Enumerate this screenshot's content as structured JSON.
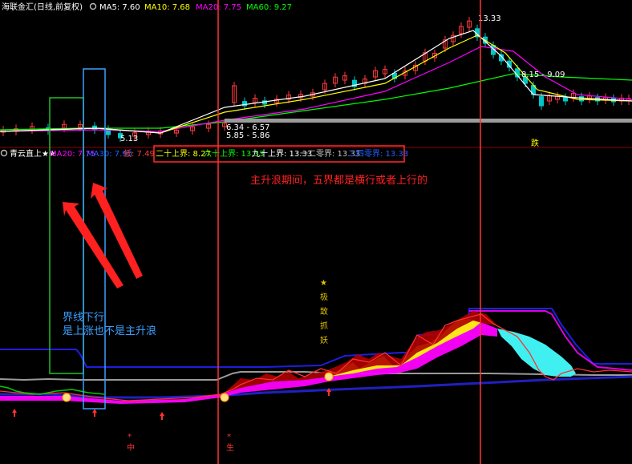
{
  "colors": {
    "bg": "#000000",
    "up": "#ff3b3b",
    "down": "#00c8c8",
    "ma5": "#ffffff",
    "ma10": "#ffff00",
    "ma20": "#ff00ff",
    "ma60": "#00ff00",
    "vline": "#ff3333",
    "blue_line": "#1e1ee0",
    "magenta_fill": "#ff00ff",
    "cyan_fill": "#40f0f0",
    "annotation_red": "#ff2020",
    "annotation_blue": "#3ca0ff"
  },
  "upper": {
    "title": "海联金汇(日线,前复权)",
    "ma5_label": "MA5: 7.60",
    "ma10_label": "MA10: 7.68",
    "ma20_label": "MA20: 7.75",
    "ma60_label": "MA60: 9.27",
    "high_label": "13.33",
    "mid_label": "8.15 - 9.09",
    "price_label_a": "6.34 - 6.57",
    "price_label_b": "5.85 - 5.86",
    "low_label": "5.13",
    "bottom_tag": "跌"
  },
  "lower": {
    "title": "青云直上★★",
    "ma20_label": "MA20: 7.75",
    "ma30_label": "MA30: 7.90",
    "low_label": "低: 7.49",
    "boundaries": [
      {
        "label": "二十上界: 8.27",
        "color": "#ffff00"
      },
      {
        "label": "六十上界: 13.33",
        "color": "#00ff00"
      },
      {
        "label": "九十上界: 13.33",
        "color": "#ffffff"
      },
      {
        "label": "一二零界: 13.33",
        "color": "#c0c0c0"
      },
      {
        "label": "二四零界: 13.33",
        "color": "#2060ff"
      }
    ],
    "annotation_main": "主升浪期间，五界都是横行或者上行的",
    "annotation_left_1": "界线下行",
    "annotation_left_2": "是上涨也不是主升浪",
    "vertical_signal": [
      "★",
      "极",
      "致",
      "抓",
      "妖"
    ],
    "bottom_marker_a": "中",
    "bottom_marker_b": "生"
  },
  "chart_data": [
    {
      "type": "candlestick",
      "title": "海联金汇(日线,前复权)",
      "series": [
        {
          "name": "MA5",
          "values": [
            5.9,
            5.9,
            5.95,
            5.95,
            6.0,
            6.1,
            6.6,
            7.1,
            7.6,
            8.2,
            9.5,
            11.0,
            12.0,
            11.0,
            9.8,
            8.5,
            7.9,
            7.7,
            7.6
          ]
        },
        {
          "name": "MA10",
          "values": [
            5.9,
            5.9,
            5.9,
            5.95,
            5.95,
            6.05,
            6.4,
            6.8,
            7.3,
            7.9,
            8.9,
            10.2,
            11.4,
            11.2,
            10.2,
            9.0,
            8.2,
            7.8,
            7.68
          ]
        },
        {
          "name": "MA20",
          "values": [
            5.9,
            5.9,
            5.9,
            5.9,
            5.95,
            6.0,
            6.2,
            6.5,
            6.9,
            7.4,
            8.2,
            9.2,
            10.4,
            10.8,
            10.3,
            9.4,
            8.5,
            8.0,
            7.75
          ]
        },
        {
          "name": "MA60",
          "values": [
            6.2,
            6.1,
            6.0,
            5.95,
            5.9,
            5.9,
            6.0,
            6.2,
            6.5,
            6.9,
            7.4,
            8.0,
            8.6,
            9.0,
            9.3,
            9.4,
            9.35,
            9.3,
            9.27
          ]
        }
      ],
      "annotations": [
        "13.33",
        "8.15 - 9.09",
        "6.34 - 6.57",
        "5.85 - 5.86",
        "5.13"
      ]
    },
    {
      "type": "line",
      "title": "青云直上★★",
      "series": [
        {
          "name": "二十上界",
          "last": 8.27
        },
        {
          "name": "六十上界",
          "last": 13.33
        },
        {
          "name": "九十上界",
          "last": 13.33
        },
        {
          "name": "一二零界",
          "last": 13.33
        },
        {
          "name": "二四零界",
          "last": 13.33
        }
      ]
    }
  ]
}
